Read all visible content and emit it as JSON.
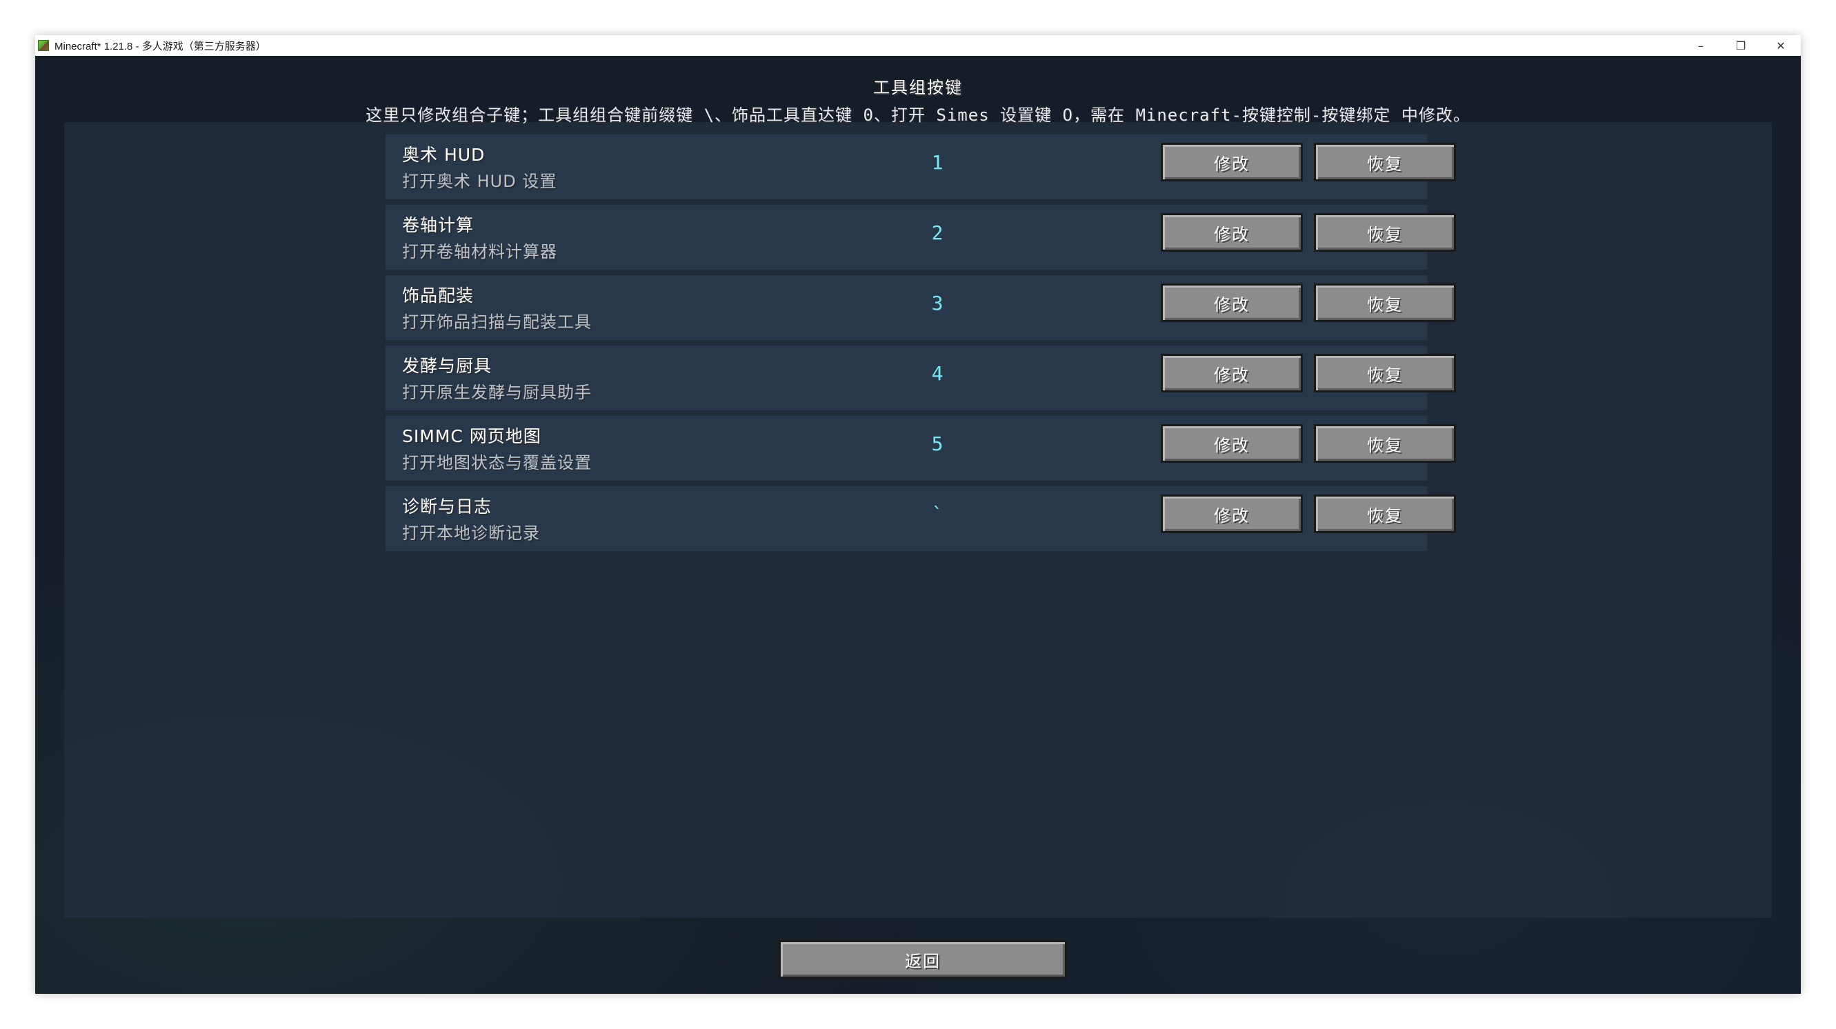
{
  "window": {
    "title": "Minecraft* 1.21.8 - 多人游戏（第三方服务器）",
    "controls": {
      "minimize": "–",
      "restore": "❐",
      "close": "✕"
    }
  },
  "screen": {
    "title": "工具组按键",
    "subtitle": "这里只修改组合子键；工具组组合键前缀键 \\、饰品工具直达键 0、打开 Simes 设置键 O，需在 Minecraft-按键控制-按键绑定 中修改。"
  },
  "rows": [
    {
      "name": "奥术 HUD",
      "desc": "打开奥术 HUD 设置",
      "key": "1",
      "modify": "修改",
      "restore": "恢复"
    },
    {
      "name": "卷轴计算",
      "desc": "打开卷轴材料计算器",
      "key": "2",
      "modify": "修改",
      "restore": "恢复"
    },
    {
      "name": "饰品配装",
      "desc": "打开饰品扫描与配装工具",
      "key": "3",
      "modify": "修改",
      "restore": "恢复"
    },
    {
      "name": "发酵与厨具",
      "desc": "打开原生发酵与厨具助手",
      "key": "4",
      "modify": "修改",
      "restore": "恢复"
    },
    {
      "name": "SIMMC 网页地图",
      "desc": "打开地图状态与覆盖设置",
      "key": "5",
      "modify": "修改",
      "restore": "恢复"
    },
    {
      "name": "诊断与日志",
      "desc": "打开本地诊断记录",
      "key": "`",
      "modify": "修改",
      "restore": "恢复"
    }
  ],
  "footer": {
    "back": "返回"
  },
  "colors": {
    "key_text": "#7fe3f5",
    "row_bg": "#28384a",
    "button_face": "#8c8c8c"
  }
}
